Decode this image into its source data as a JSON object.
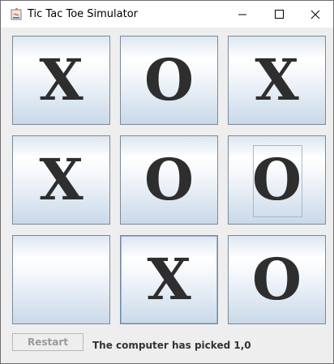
{
  "window": {
    "title": "Tic Tac Toe Simulator",
    "icon": "java-app-icon"
  },
  "board": {
    "cells": [
      {
        "row": 0,
        "col": 0,
        "mark": "X"
      },
      {
        "row": 0,
        "col": 1,
        "mark": "O"
      },
      {
        "row": 0,
        "col": 2,
        "mark": "X"
      },
      {
        "row": 1,
        "col": 0,
        "mark": "X"
      },
      {
        "row": 1,
        "col": 1,
        "mark": "O"
      },
      {
        "row": 1,
        "col": 2,
        "mark": "O"
      },
      {
        "row": 2,
        "col": 0,
        "mark": ""
      },
      {
        "row": 2,
        "col": 1,
        "mark": "X"
      },
      {
        "row": 2,
        "col": 2,
        "mark": "O"
      }
    ]
  },
  "footer": {
    "restart_label": "Restart",
    "status_text": "The computer has picked 1,0"
  }
}
